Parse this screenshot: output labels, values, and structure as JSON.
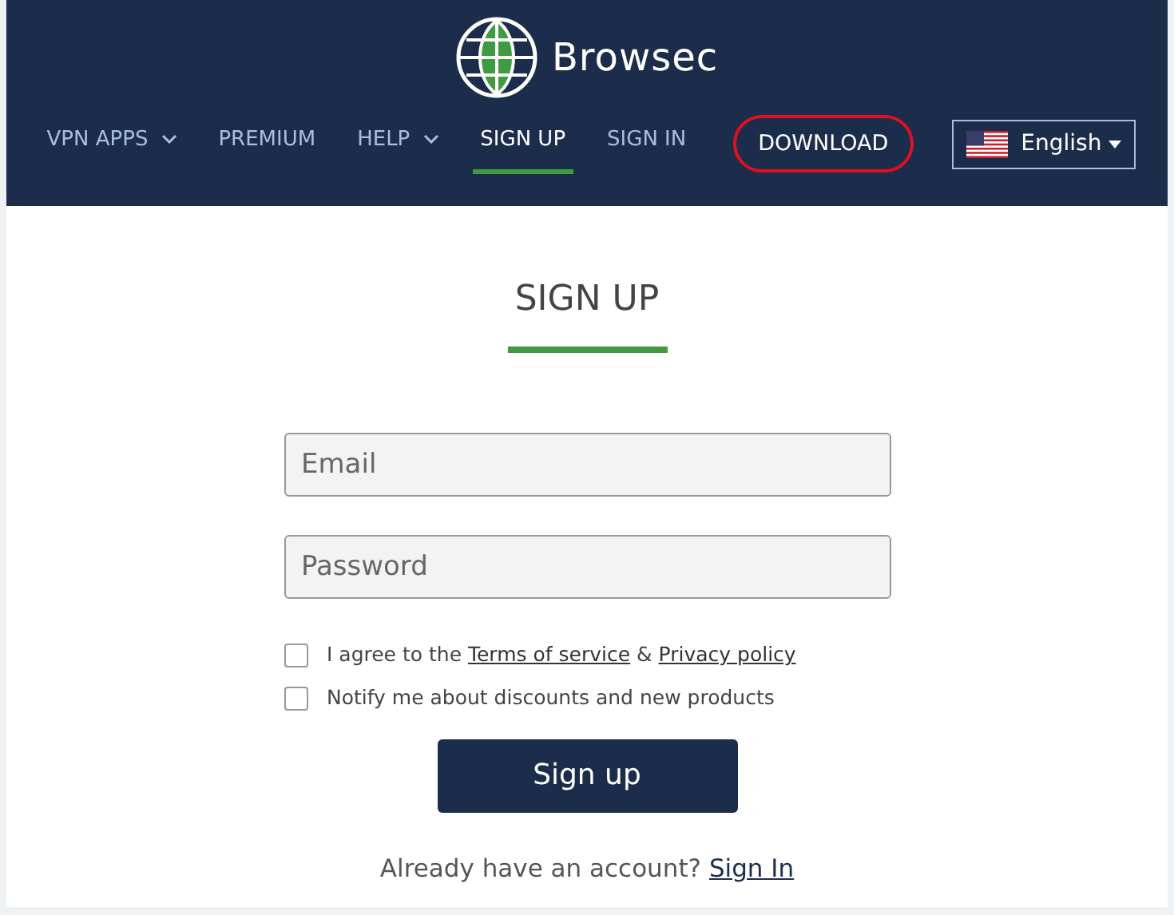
{
  "brand": {
    "name": "Browsec"
  },
  "nav": [
    {
      "label": "VPN APPS",
      "dropdown": true,
      "selected": false
    },
    {
      "label": "PREMIUM",
      "dropdown": false,
      "selected": false
    },
    {
      "label": "HELP",
      "dropdown": true,
      "selected": false
    },
    {
      "label": "SIGN UP",
      "dropdown": false,
      "selected": true
    },
    {
      "label": "SIGN IN",
      "dropdown": false,
      "selected": false
    }
  ],
  "download": {
    "label": "DOWNLOAD"
  },
  "language": {
    "label": "English"
  },
  "form": {
    "title": "SIGN UP",
    "fields": [
      {
        "placeholder": "Email"
      },
      {
        "placeholder": "Password"
      }
    ],
    "checkboxes": [
      {
        "parts": [
          {
            "kind": "text",
            "text": "I agree to the "
          },
          {
            "kind": "link",
            "text": "Terms of service"
          },
          {
            "kind": "text",
            "text": " & "
          },
          {
            "kind": "link",
            "text": "Privacy policy"
          }
        ],
        "checked": false
      },
      {
        "parts": [
          {
            "kind": "text",
            "text": "Notify me about discounts and new products"
          }
        ],
        "checked": false
      }
    ],
    "submit": "Sign up",
    "footer": {
      "text": "Already have an account? ",
      "link": "Sign In"
    }
  }
}
